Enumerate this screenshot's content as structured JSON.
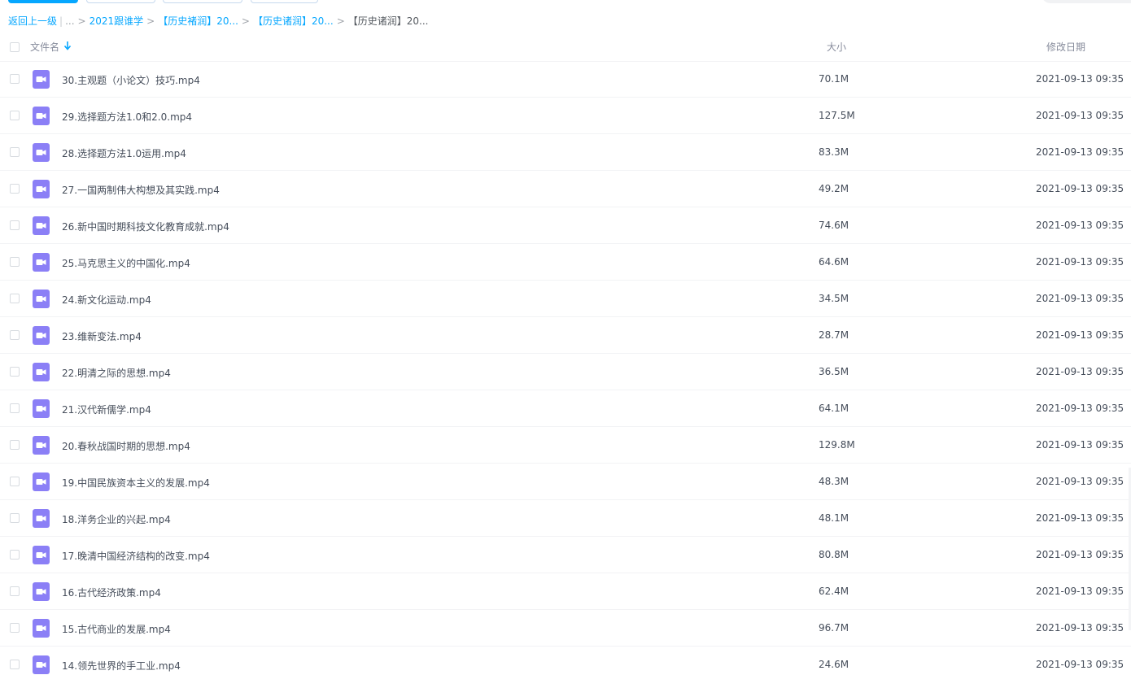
{
  "breadcrumb": {
    "back": "返回上一级",
    "pipe": "|",
    "ellipsis": "...",
    "sep": ">",
    "items": [
      "2021跟谁学",
      "【历史褚润】20...",
      "【历史诸润】20..."
    ],
    "current": "【历史诸润】20..."
  },
  "header": {
    "name": "文件名",
    "size": "大小",
    "date": "修改日期"
  },
  "files": [
    {
      "name": "30.主观题（小论文）技巧.mp4",
      "size": "70.1M",
      "date": "2021-09-13 09:35"
    },
    {
      "name": "29.选择题方法1.0和2.0.mp4",
      "size": "127.5M",
      "date": "2021-09-13 09:35"
    },
    {
      "name": "28.选择题方法1.0运用.mp4",
      "size": "83.3M",
      "date": "2021-09-13 09:35"
    },
    {
      "name": "27.一国两制伟大构想及其实践.mp4",
      "size": "49.2M",
      "date": "2021-09-13 09:35"
    },
    {
      "name": "26.新中国时期科技文化教育成就.mp4",
      "size": "74.6M",
      "date": "2021-09-13 09:35"
    },
    {
      "name": "25.马克思主义的中国化.mp4",
      "size": "64.6M",
      "date": "2021-09-13 09:35"
    },
    {
      "name": "24.新文化运动.mp4",
      "size": "34.5M",
      "date": "2021-09-13 09:35"
    },
    {
      "name": "23.维新变法.mp4",
      "size": "28.7M",
      "date": "2021-09-13 09:35"
    },
    {
      "name": "22.明清之际的思想.mp4",
      "size": "36.5M",
      "date": "2021-09-13 09:35"
    },
    {
      "name": "21.汉代新儒学.mp4",
      "size": "64.1M",
      "date": "2021-09-13 09:35"
    },
    {
      "name": "20.春秋战国时期的思想.mp4",
      "size": "129.8M",
      "date": "2021-09-13 09:35"
    },
    {
      "name": "19.中国民族资本主义的发展.mp4",
      "size": "48.3M",
      "date": "2021-09-13 09:35"
    },
    {
      "name": "18.洋务企业的兴起.mp4",
      "size": "48.1M",
      "date": "2021-09-13 09:35"
    },
    {
      "name": "17.晚清中国经济结构的改变.mp4",
      "size": "80.8M",
      "date": "2021-09-13 09:35"
    },
    {
      "name": "16.古代经济政策.mp4",
      "size": "62.4M",
      "date": "2021-09-13 09:35"
    },
    {
      "name": "15.古代商业的发展.mp4",
      "size": "96.7M",
      "date": "2021-09-13 09:35"
    },
    {
      "name": "14.领先世界的手工业.mp4",
      "size": "24.6M",
      "date": "2021-09-13 09:35"
    }
  ],
  "icons": {
    "file": "video-file-icon",
    "sort": "sort-down-arrow-icon"
  },
  "colors": {
    "accent": "#06a7ff",
    "video_icon": "#8b7ff6"
  }
}
